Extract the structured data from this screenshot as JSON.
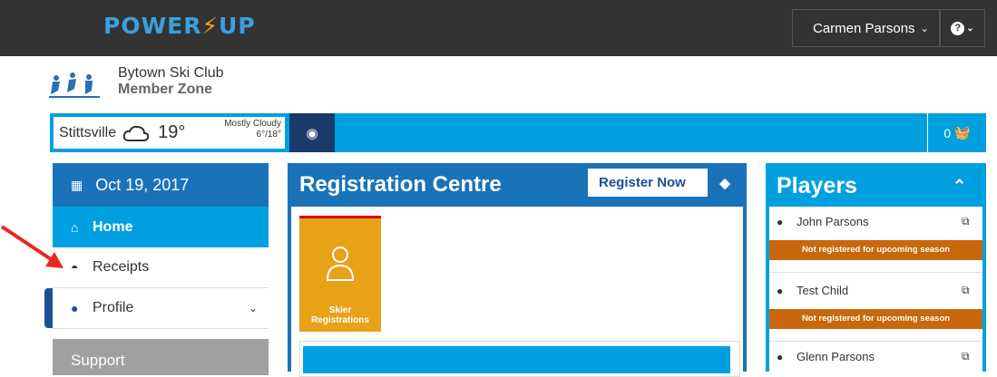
{
  "brand": {
    "logo_part1": "POWER",
    "logo_part2": "UP",
    "accent_color": "#00a0e0",
    "dark_blue": "#1a73b8"
  },
  "header": {
    "user_name": "Carmen Parsons",
    "help_label": "?"
  },
  "club": {
    "name": "Bytown Ski Club",
    "zone": "Member Zone"
  },
  "weather": {
    "city": "Stittsville",
    "temp": "19°",
    "condition": "Mostly Cloudy",
    "range": "6°/18°"
  },
  "cart": {
    "count": "0"
  },
  "sidebar": {
    "date": "Oct 19, 2017",
    "items": [
      {
        "label": "Home",
        "icon": "home-icon",
        "active": true
      },
      {
        "label": "Receipts",
        "icon": "receipts-icon"
      },
      {
        "label": "Profile",
        "icon": "user-icon"
      }
    ],
    "support_label": "Support"
  },
  "registration": {
    "title": "Registration Centre",
    "register_button": "Register Now",
    "tile_label": "Skier Registrations"
  },
  "players": {
    "title": "Players",
    "list": [
      {
        "name": "John Parsons",
        "status": "Not registered for upcoming season"
      },
      {
        "name": "Test Child",
        "status": "Not registered for upcoming season"
      },
      {
        "name": "Glenn Parsons"
      }
    ]
  }
}
